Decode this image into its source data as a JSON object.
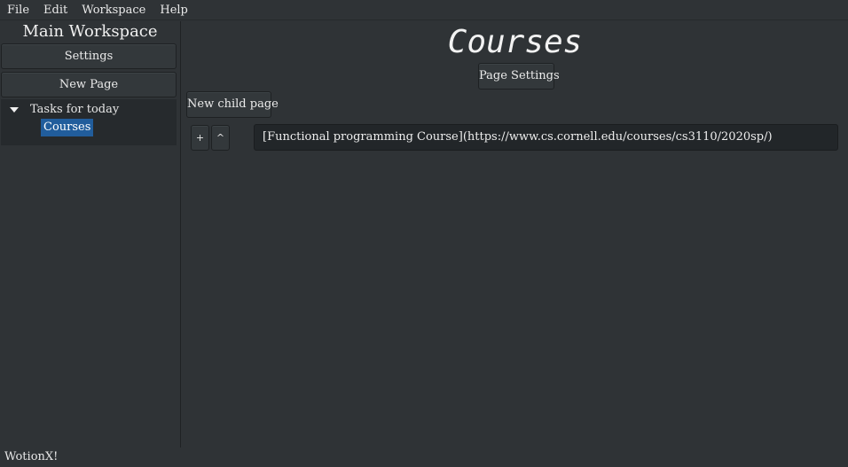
{
  "menubar": {
    "items": [
      "File",
      "Edit",
      "Workspace",
      "Help"
    ]
  },
  "sidebar": {
    "workspace_title": "Main Workspace",
    "settings_label": "Settings",
    "new_page_label": "New Page",
    "tree": {
      "root_label": "Tasks for today",
      "root_expanded": true,
      "children": [
        {
          "label": "Courses",
          "selected": true
        }
      ]
    }
  },
  "main": {
    "page_title": "Courses",
    "page_settings_label": "Page Settings",
    "new_child_page_label": "New child page",
    "block": {
      "add_label": "+",
      "move_up_label": "^",
      "content": "[Functional programming Course](https://www.cs.cornell.edu/courses/cs3110/2020sp/)"
    }
  },
  "statusbar": {
    "text": "WotionX!"
  },
  "colors": {
    "background": "#2f3336",
    "selection": "#215d9c",
    "input_background": "#222629"
  }
}
